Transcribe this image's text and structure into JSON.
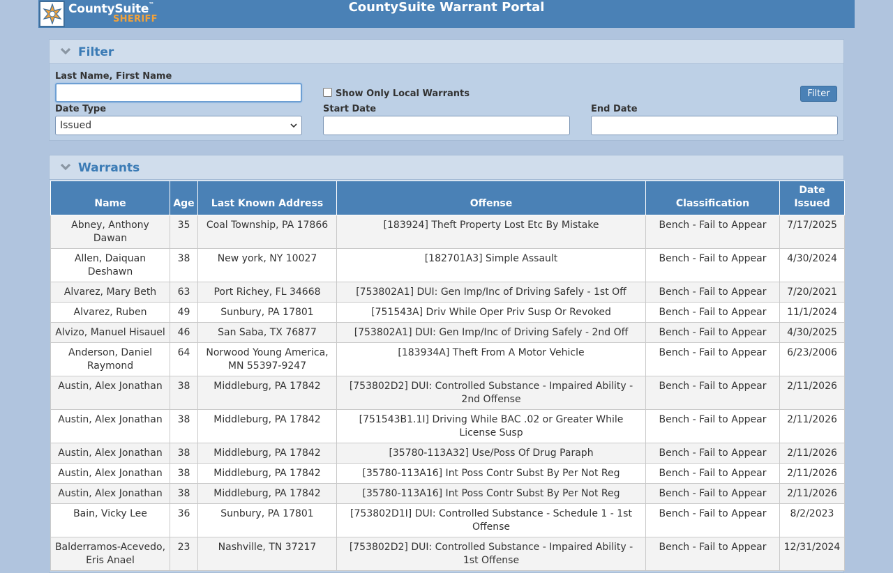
{
  "header": {
    "logo_name": "CountySuite",
    "logo_tm": "™",
    "logo_sub": "SHERIFF",
    "portal_title": "CountySuite Warrant Portal"
  },
  "filter": {
    "title": "Filter",
    "name_label": "Last Name, First Name",
    "name_value": "",
    "local_only_label": "Show Only Local Warrants",
    "date_type_label": "Date Type",
    "date_type_value": "Issued",
    "start_date_label": "Start Date",
    "end_date_label": "End Date",
    "filter_button": "Filter"
  },
  "warrants": {
    "title": "Warrants",
    "columns": [
      "Name",
      "Age",
      "Last Known Address",
      "Offense",
      "Classification",
      "Date Issued"
    ],
    "rows": [
      [
        "Abney, Anthony Dawan",
        "35",
        "Coal Township, PA 17866",
        "[183924] Theft Property Lost Etc By Mistake",
        "Bench - Fail to Appear",
        "7/17/2025"
      ],
      [
        "Allen, Daiquan Deshawn",
        "38",
        "New york, NY 10027",
        "[182701A3] Simple Assault",
        "Bench - Fail to Appear",
        "4/30/2024"
      ],
      [
        "Alvarez, Mary Beth",
        "63",
        "Port Richey, FL 34668",
        "[753802A1] DUI: Gen Imp/Inc of Driving Safely - 1st Off",
        "Bench - Fail to Appear",
        "7/20/2021"
      ],
      [
        "Alvarez, Ruben",
        "49",
        "Sunbury, PA 17801",
        "[751543A] Driv While Oper Priv Susp Or Revoked",
        "Bench - Fail to Appear",
        "11/1/2024"
      ],
      [
        "Alvizo, Manuel Hisauel",
        "46",
        "San Saba, TX 76877",
        "[753802A1] DUI: Gen Imp/Inc of Driving Safely - 2nd Off",
        "Bench - Fail to Appear",
        "4/30/2025"
      ],
      [
        "Anderson, Daniel Raymond",
        "64",
        "Norwood Young America, MN 55397-9247",
        "[183934A] Theft From A Motor Vehicle",
        "Bench - Fail to Appear",
        "6/23/2006"
      ],
      [
        "Austin, Alex Jonathan",
        "38",
        "Middleburg, PA 17842",
        "[753802D2] DUI: Controlled Substance - Impaired Ability - 2nd Offense",
        "Bench - Fail to Appear",
        "2/11/2026"
      ],
      [
        "Austin, Alex Jonathan",
        "38",
        "Middleburg, PA 17842",
        "[751543B1.1I] Driving While BAC .02 or Greater While License Susp",
        "Bench - Fail to Appear",
        "2/11/2026"
      ],
      [
        "Austin, Alex Jonathan",
        "38",
        "Middleburg, PA 17842",
        "[35780-113A32] Use/Poss Of Drug Paraph",
        "Bench - Fail to Appear",
        "2/11/2026"
      ],
      [
        "Austin, Alex Jonathan",
        "38",
        "Middleburg, PA 17842",
        "[35780-113A16] Int Poss Contr Subst By Per Not Reg",
        "Bench - Fail to Appear",
        "2/11/2026"
      ],
      [
        "Austin, Alex Jonathan",
        "38",
        "Middleburg, PA 17842",
        "[35780-113A16] Int Poss Contr Subst By Per Not Reg",
        "Bench - Fail to Appear",
        "2/11/2026"
      ],
      [
        "Bain, Vicky Lee",
        "36",
        "Sunbury, PA 17801",
        "[753802D1I] DUI: Controlled Substance - Schedule 1 - 1st Offense",
        "Bench - Fail to Appear",
        "8/2/2023"
      ],
      [
        "Balderramos-Acevedo, Eris Anael",
        "23",
        "Nashville, TN 37217",
        "[753802D2] DUI: Controlled Substance - Impaired Ability - 1st Offense",
        "Bench - Fail to Appear",
        "12/31/2024"
      ]
    ]
  },
  "colors": {
    "page_bg": "#b0c4de",
    "header_bg": "#4a81b6",
    "accent_orange": "#f2a23a",
    "panel_title": "#3b7bb5"
  },
  "icons": {
    "logo": "sheriff-star-icon",
    "collapse": "chevron-down-icon",
    "select_arrow": "chevron-down-icon"
  }
}
